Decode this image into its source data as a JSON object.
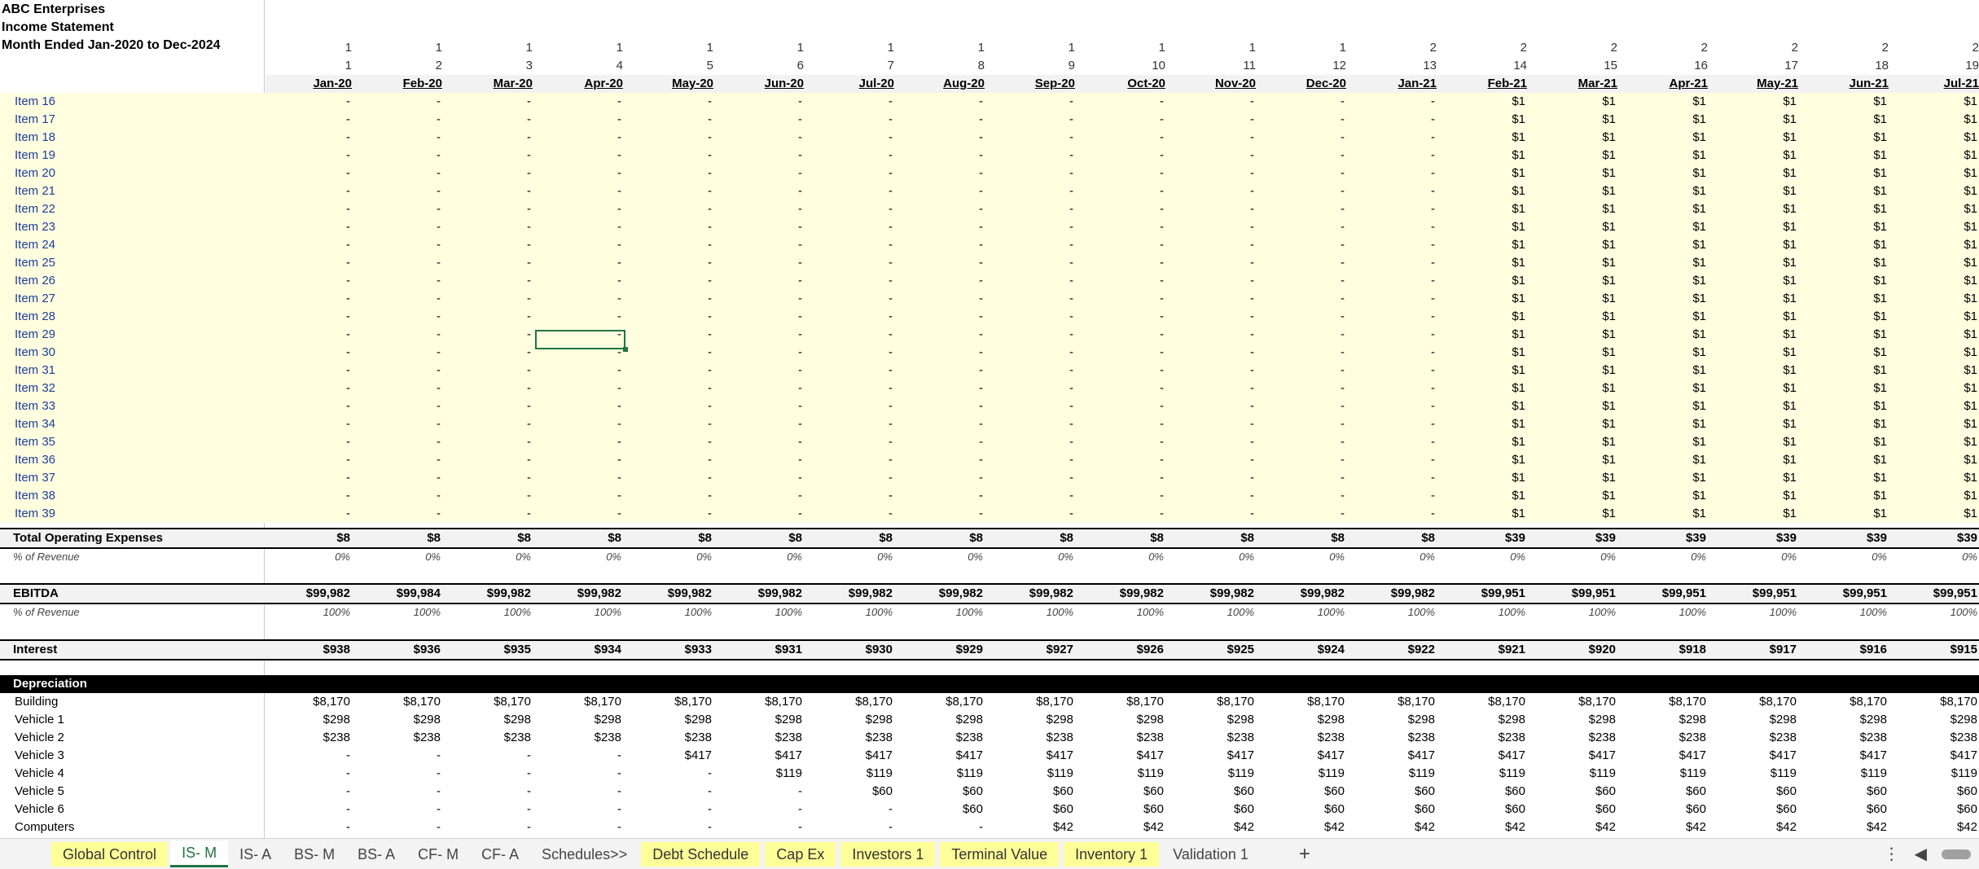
{
  "header": {
    "company": "ABC Enterprises",
    "statement": "Income Statement",
    "period": "Month Ended Jan-2020 to Dec-2024"
  },
  "columns": {
    "years": [
      "1",
      "1",
      "1",
      "1",
      "1",
      "1",
      "1",
      "1",
      "1",
      "1",
      "1",
      "1",
      "2",
      "2",
      "2",
      "2",
      "2",
      "2",
      "2"
    ],
    "indexes": [
      "1",
      "2",
      "3",
      "4",
      "5",
      "6",
      "7",
      "8",
      "9",
      "10",
      "11",
      "12",
      "13",
      "14",
      "15",
      "16",
      "17",
      "18",
      "19"
    ],
    "months": [
      "Jan-20",
      "Feb-20",
      "Mar-20",
      "Apr-20",
      "May-20",
      "Jun-20",
      "Jul-20",
      "Aug-20",
      "Sep-20",
      "Oct-20",
      "Nov-20",
      "Dec-20",
      "Jan-21",
      "Feb-21",
      "Mar-21",
      "Apr-21",
      "May-21",
      "Jun-21",
      "Jul-21"
    ]
  },
  "items": [
    {
      "label": "Item 16",
      "values": [
        "-",
        "-",
        "-",
        "-",
        "-",
        "-",
        "-",
        "-",
        "-",
        "-",
        "-",
        "-",
        "-",
        "$1",
        "$1",
        "$1",
        "$1",
        "$1",
        "$1"
      ]
    },
    {
      "label": "Item 17",
      "values": [
        "-",
        "-",
        "-",
        "-",
        "-",
        "-",
        "-",
        "-",
        "-",
        "-",
        "-",
        "-",
        "-",
        "$1",
        "$1",
        "$1",
        "$1",
        "$1",
        "$1"
      ]
    },
    {
      "label": "Item 18",
      "values": [
        "-",
        "-",
        "-",
        "-",
        "-",
        "-",
        "-",
        "-",
        "-",
        "-",
        "-",
        "-",
        "-",
        "$1",
        "$1",
        "$1",
        "$1",
        "$1",
        "$1"
      ]
    },
    {
      "label": "Item 19",
      "values": [
        "-",
        "-",
        "-",
        "-",
        "-",
        "-",
        "-",
        "-",
        "-",
        "-",
        "-",
        "-",
        "-",
        "$1",
        "$1",
        "$1",
        "$1",
        "$1",
        "$1"
      ]
    },
    {
      "label": "Item 20",
      "values": [
        "-",
        "-",
        "-",
        "-",
        "-",
        "-",
        "-",
        "-",
        "-",
        "-",
        "-",
        "-",
        "-",
        "$1",
        "$1",
        "$1",
        "$1",
        "$1",
        "$1"
      ]
    },
    {
      "label": "Item 21",
      "values": [
        "-",
        "-",
        "-",
        "-",
        "-",
        "-",
        "-",
        "-",
        "-",
        "-",
        "-",
        "-",
        "-",
        "$1",
        "$1",
        "$1",
        "$1",
        "$1",
        "$1"
      ]
    },
    {
      "label": "Item 22",
      "values": [
        "-",
        "-",
        "-",
        "-",
        "-",
        "-",
        "-",
        "-",
        "-",
        "-",
        "-",
        "-",
        "-",
        "$1",
        "$1",
        "$1",
        "$1",
        "$1",
        "$1"
      ]
    },
    {
      "label": "Item 23",
      "values": [
        "-",
        "-",
        "-",
        "-",
        "-",
        "-",
        "-",
        "-",
        "-",
        "-",
        "-",
        "-",
        "-",
        "$1",
        "$1",
        "$1",
        "$1",
        "$1",
        "$1"
      ]
    },
    {
      "label": "Item 24",
      "values": [
        "-",
        "-",
        "-",
        "-",
        "-",
        "-",
        "-",
        "-",
        "-",
        "-",
        "-",
        "-",
        "-",
        "$1",
        "$1",
        "$1",
        "$1",
        "$1",
        "$1"
      ]
    },
    {
      "label": "Item 25",
      "values": [
        "-",
        "-",
        "-",
        "-",
        "-",
        "-",
        "-",
        "-",
        "-",
        "-",
        "-",
        "-",
        "-",
        "$1",
        "$1",
        "$1",
        "$1",
        "$1",
        "$1"
      ]
    },
    {
      "label": "Item 26",
      "values": [
        "-",
        "-",
        "-",
        "-",
        "-",
        "-",
        "-",
        "-",
        "-",
        "-",
        "-",
        "-",
        "-",
        "$1",
        "$1",
        "$1",
        "$1",
        "$1",
        "$1"
      ]
    },
    {
      "label": "Item 27",
      "values": [
        "-",
        "-",
        "-",
        "-",
        "-",
        "-",
        "-",
        "-",
        "-",
        "-",
        "-",
        "-",
        "-",
        "$1",
        "$1",
        "$1",
        "$1",
        "$1",
        "$1"
      ]
    },
    {
      "label": "Item 28",
      "values": [
        "-",
        "-",
        "-",
        "-",
        "-",
        "-",
        "-",
        "-",
        "-",
        "-",
        "-",
        "-",
        "-",
        "$1",
        "$1",
        "$1",
        "$1",
        "$1",
        "$1"
      ]
    },
    {
      "label": "Item 29",
      "values": [
        "-",
        "-",
        "-",
        "-",
        "-",
        "-",
        "-",
        "-",
        "-",
        "-",
        "-",
        "-",
        "-",
        "$1",
        "$1",
        "$1",
        "$1",
        "$1",
        "$1"
      ]
    },
    {
      "label": "Item 30",
      "values": [
        "-",
        "-",
        "-",
        "-",
        "-",
        "-",
        "-",
        "-",
        "-",
        "-",
        "-",
        "-",
        "-",
        "$1",
        "$1",
        "$1",
        "$1",
        "$1",
        "$1"
      ]
    },
    {
      "label": "Item 31",
      "values": [
        "-",
        "-",
        "-",
        "-",
        "-",
        "-",
        "-",
        "-",
        "-",
        "-",
        "-",
        "-",
        "-",
        "$1",
        "$1",
        "$1",
        "$1",
        "$1",
        "$1"
      ]
    },
    {
      "label": "Item 32",
      "values": [
        "-",
        "-",
        "-",
        "-",
        "-",
        "-",
        "-",
        "-",
        "-",
        "-",
        "-",
        "-",
        "-",
        "$1",
        "$1",
        "$1",
        "$1",
        "$1",
        "$1"
      ]
    },
    {
      "label": "Item 33",
      "values": [
        "-",
        "-",
        "-",
        "-",
        "-",
        "-",
        "-",
        "-",
        "-",
        "-",
        "-",
        "-",
        "-",
        "$1",
        "$1",
        "$1",
        "$1",
        "$1",
        "$1"
      ]
    },
    {
      "label": "Item 34",
      "values": [
        "-",
        "-",
        "-",
        "-",
        "-",
        "-",
        "-",
        "-",
        "-",
        "-",
        "-",
        "-",
        "-",
        "$1",
        "$1",
        "$1",
        "$1",
        "$1",
        "$1"
      ]
    },
    {
      "label": "Item 35",
      "values": [
        "-",
        "-",
        "-",
        "-",
        "-",
        "-",
        "-",
        "-",
        "-",
        "-",
        "-",
        "-",
        "-",
        "$1",
        "$1",
        "$1",
        "$1",
        "$1",
        "$1"
      ]
    },
    {
      "label": "Item 36",
      "values": [
        "-",
        "-",
        "-",
        "-",
        "-",
        "-",
        "-",
        "-",
        "-",
        "-",
        "-",
        "-",
        "-",
        "$1",
        "$1",
        "$1",
        "$1",
        "$1",
        "$1"
      ]
    },
    {
      "label": "Item 37",
      "values": [
        "-",
        "-",
        "-",
        "-",
        "-",
        "-",
        "-",
        "-",
        "-",
        "-",
        "-",
        "-",
        "-",
        "$1",
        "$1",
        "$1",
        "$1",
        "$1",
        "$1"
      ]
    },
    {
      "label": "Item 38",
      "values": [
        "-",
        "-",
        "-",
        "-",
        "-",
        "-",
        "-",
        "-",
        "-",
        "-",
        "-",
        "-",
        "-",
        "$1",
        "$1",
        "$1",
        "$1",
        "$1",
        "$1"
      ]
    },
    {
      "label": "Item 39",
      "values": [
        "-",
        "-",
        "-",
        "-",
        "-",
        "-",
        "-",
        "-",
        "-",
        "-",
        "-",
        "-",
        "-",
        "$1",
        "$1",
        "$1",
        "$1",
        "$1",
        "$1"
      ]
    }
  ],
  "total_opex": {
    "label": "Total Operating Expenses",
    "values": [
      "$8",
      "$8",
      "$8",
      "$8",
      "$8",
      "$8",
      "$8",
      "$8",
      "$8",
      "$8",
      "$8",
      "$8",
      "$8",
      "$39",
      "$39",
      "$39",
      "$39",
      "$39",
      "$39"
    ]
  },
  "opex_pct": {
    "label": "% of Revenue",
    "values": [
      "0%",
      "0%",
      "0%",
      "0%",
      "0%",
      "0%",
      "0%",
      "0%",
      "0%",
      "0%",
      "0%",
      "0%",
      "0%",
      "0%",
      "0%",
      "0%",
      "0%",
      "0%",
      "0%"
    ]
  },
  "ebitda": {
    "label": "EBITDA",
    "values": [
      "$99,982",
      "$99,984",
      "$99,982",
      "$99,982",
      "$99,982",
      "$99,982",
      "$99,982",
      "$99,982",
      "$99,982",
      "$99,982",
      "$99,982",
      "$99,982",
      "$99,982",
      "$99,951",
      "$99,951",
      "$99,951",
      "$99,951",
      "$99,951",
      "$99,951"
    ]
  },
  "ebitda_pct": {
    "label": "% of Revenue",
    "values": [
      "100%",
      "100%",
      "100%",
      "100%",
      "100%",
      "100%",
      "100%",
      "100%",
      "100%",
      "100%",
      "100%",
      "100%",
      "100%",
      "100%",
      "100%",
      "100%",
      "100%",
      "100%",
      "100%"
    ]
  },
  "interest": {
    "label": "Interest",
    "values": [
      "$938",
      "$936",
      "$935",
      "$934",
      "$933",
      "$931",
      "$930",
      "$929",
      "$927",
      "$926",
      "$925",
      "$924",
      "$922",
      "$921",
      "$920",
      "$918",
      "$917",
      "$916",
      "$915"
    ]
  },
  "depreciation": {
    "label": "Depreciation",
    "rows": [
      {
        "label": "Building",
        "values": [
          "$8,170",
          "$8,170",
          "$8,170",
          "$8,170",
          "$8,170",
          "$8,170",
          "$8,170",
          "$8,170",
          "$8,170",
          "$8,170",
          "$8,170",
          "$8,170",
          "$8,170",
          "$8,170",
          "$8,170",
          "$8,170",
          "$8,170",
          "$8,170",
          "$8,170"
        ]
      },
      {
        "label": "Vehicle 1",
        "values": [
          "$298",
          "$298",
          "$298",
          "$298",
          "$298",
          "$298",
          "$298",
          "$298",
          "$298",
          "$298",
          "$298",
          "$298",
          "$298",
          "$298",
          "$298",
          "$298",
          "$298",
          "$298",
          "$298"
        ]
      },
      {
        "label": "Vehicle 2",
        "values": [
          "$238",
          "$238",
          "$238",
          "$238",
          "$238",
          "$238",
          "$238",
          "$238",
          "$238",
          "$238",
          "$238",
          "$238",
          "$238",
          "$238",
          "$238",
          "$238",
          "$238",
          "$238",
          "$238"
        ]
      },
      {
        "label": "Vehicle 3",
        "values": [
          "-",
          "-",
          "-",
          "-",
          "$417",
          "$417",
          "$417",
          "$417",
          "$417",
          "$417",
          "$417",
          "$417",
          "$417",
          "$417",
          "$417",
          "$417",
          "$417",
          "$417",
          "$417"
        ]
      },
      {
        "label": "Vehicle 4",
        "values": [
          "-",
          "-",
          "-",
          "-",
          "-",
          "$119",
          "$119",
          "$119",
          "$119",
          "$119",
          "$119",
          "$119",
          "$119",
          "$119",
          "$119",
          "$119",
          "$119",
          "$119",
          "$119"
        ]
      },
      {
        "label": "Vehicle 5",
        "values": [
          "-",
          "-",
          "-",
          "-",
          "-",
          "-",
          "$60",
          "$60",
          "$60",
          "$60",
          "$60",
          "$60",
          "$60",
          "$60",
          "$60",
          "$60",
          "$60",
          "$60",
          "$60"
        ]
      },
      {
        "label": "Vehicle 6",
        "values": [
          "-",
          "-",
          "-",
          "-",
          "-",
          "-",
          "-",
          "$60",
          "$60",
          "$60",
          "$60",
          "$60",
          "$60",
          "$60",
          "$60",
          "$60",
          "$60",
          "$60",
          "$60"
        ]
      },
      {
        "label": "Computers",
        "values": [
          "-",
          "-",
          "-",
          "-",
          "-",
          "-",
          "-",
          "-",
          "$42",
          "$42",
          "$42",
          "$42",
          "$42",
          "$42",
          "$42",
          "$42",
          "$42",
          "$42",
          "$42"
        ]
      }
    ]
  },
  "tabs": [
    {
      "name": "Global Control",
      "style": "yellow"
    },
    {
      "name": "IS- M",
      "style": "active"
    },
    {
      "name": "IS- A",
      "style": "plain"
    },
    {
      "name": "BS- M",
      "style": "plain"
    },
    {
      "name": "BS- A",
      "style": "plain"
    },
    {
      "name": "CF- M",
      "style": "plain"
    },
    {
      "name": "CF- A",
      "style": "plain"
    },
    {
      "name": "Schedules>>",
      "style": "white"
    },
    {
      "name": "Debt Schedule",
      "style": "yellow"
    },
    {
      "name": "Cap Ex",
      "style": "yellow"
    },
    {
      "name": "Investors 1",
      "style": "yellow"
    },
    {
      "name": "Terminal Value",
      "style": "yellow"
    },
    {
      "name": "Inventory 1",
      "style": "yellow"
    },
    {
      "name": "Validation 1",
      "style": "plain"
    }
  ],
  "controls": {
    "add_tab": "+",
    "more": "⋮",
    "scroll_left": "◀"
  },
  "colors": {
    "accent": "#217346",
    "input_fill": "#ffffe0",
    "tab_yellow": "#ffff99",
    "item_text": "#1f3c99"
  }
}
